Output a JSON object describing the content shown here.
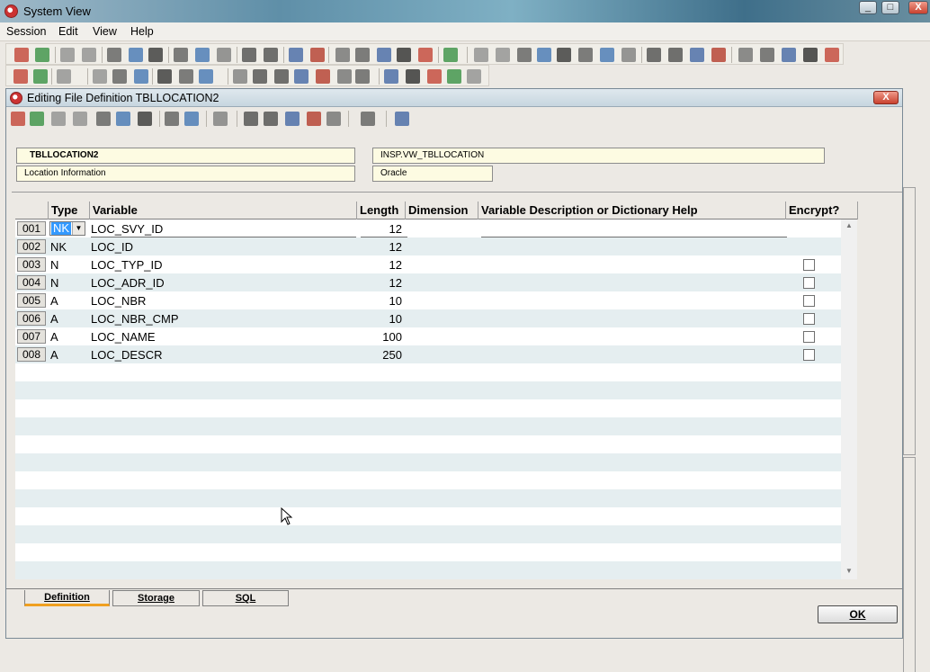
{
  "window": {
    "title": "System View",
    "minimize": "_",
    "maximize": "□",
    "close": "X"
  },
  "menu": [
    "Session",
    "Edit",
    "View",
    "Help"
  ],
  "dialog": {
    "title": "Editing File Definition TBLLOCATION2",
    "close": "X",
    "file_name": "TBLLOCATION2",
    "file_description": "Location Information",
    "db_object": "INSP.VW_TBLLOCATION",
    "db_type": "Oracle"
  },
  "grid": {
    "headers": [
      "Type",
      "Variable",
      "Length",
      "Dimension",
      "Variable Description or Dictionary Help",
      "Encrypt?"
    ],
    "rows": [
      {
        "num": "001",
        "type": "NK",
        "variable": "LOC_SVY_ID",
        "length": "12",
        "encrypt": false,
        "editing": true
      },
      {
        "num": "002",
        "type": "NK",
        "variable": "LOC_ID",
        "length": "12",
        "encrypt": false
      },
      {
        "num": "003",
        "type": "N",
        "variable": "LOC_TYP_ID",
        "length": "12",
        "encrypt": true
      },
      {
        "num": "004",
        "type": "N",
        "variable": "LOC_ADR_ID",
        "length": "12",
        "encrypt": true
      },
      {
        "num": "005",
        "type": "A",
        "variable": "LOC_NBR",
        "length": "10",
        "encrypt": true
      },
      {
        "num": "006",
        "type": "A",
        "variable": "LOC_NBR_CMP",
        "length": "10",
        "encrypt": true
      },
      {
        "num": "007",
        "type": "A",
        "variable": "LOC_NAME",
        "length": "100",
        "encrypt": true
      },
      {
        "num": "008",
        "type": "A",
        "variable": "LOC_DESCR",
        "length": "250",
        "encrypt": true
      }
    ],
    "scroll_up": "▲",
    "scroll_down": "▼"
  },
  "tabs": [
    "Definition",
    "Storage",
    "SQL"
  ],
  "ok_button": "OK",
  "toolbar_icon_colors": [
    "#c0392b",
    "#2e8b3a",
    "#8a8a8a",
    "#8a8a8a",
    "#555555",
    "#3a6fb0",
    "#2b2b2b",
    "#555555",
    "#3a6fb0",
    "#777777",
    "#444444",
    "#444444",
    "#3a5fa0",
    "#b03020",
    "#6a6a6a",
    "#555555",
    "#3a5fa0",
    "#222222"
  ]
}
